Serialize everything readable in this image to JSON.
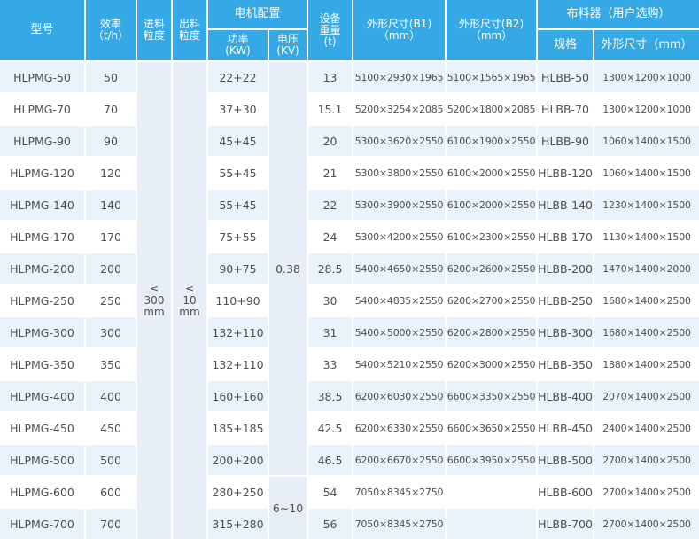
{
  "header": {
    "model": "型号",
    "efficiency": [
      "效率",
      "（t/h）"
    ],
    "feed_size": [
      "进料",
      "粒度"
    ],
    "discharge_size": [
      "出料",
      "粒度"
    ],
    "motor": "电机配置",
    "power": [
      "功率",
      "(KW)"
    ],
    "voltage": [
      "电压",
      "(KV)"
    ],
    "weight": [
      "设备",
      "重量",
      "(t)"
    ],
    "dim_b1": [
      "外形尺寸(B1)",
      "（mm）"
    ],
    "dim_b2": [
      "外形尺寸(B2)",
      "（mm）"
    ],
    "distributor": "布料器（用户选购）",
    "spec": "规格",
    "dist_dim": "外形尺寸（mm）"
  },
  "merged": {
    "feed_size": [
      "≤",
      "300",
      "mm"
    ],
    "discharge_size": [
      "≤",
      "10",
      "mm"
    ],
    "voltage_low": "0.38",
    "voltage_high": "6~10"
  },
  "rows": [
    {
      "model": "HLPMG-50",
      "eff": "50",
      "power": "22+22",
      "weight": "13",
      "b1": "5100×2930×1965",
      "b2": "5100×1565×1965",
      "spec": "HLBB-50",
      "dim": "1300×1200×1000"
    },
    {
      "model": "HLPMG-70",
      "eff": "70",
      "power": "37+30",
      "weight": "15.1",
      "b1": "5200×3254×2085",
      "b2": "5200×1800×2085",
      "spec": "HLBB-70",
      "dim": "1300×1200×1000"
    },
    {
      "model": "HLPMG-90",
      "eff": "90",
      "power": "45+45",
      "weight": "20",
      "b1": "5300×3620×2550",
      "b2": "6100×1900×2550",
      "spec": "HLBB-90",
      "dim": "1060×1400×1500"
    },
    {
      "model": "HLPMG-120",
      "eff": "120",
      "power": "55+45",
      "weight": "21",
      "b1": "5300×3800×2550",
      "b2": "6100×2000×2550",
      "spec": "HLBB-120",
      "dim": "1060×1400×1500"
    },
    {
      "model": "HLPMG-140",
      "eff": "140",
      "power": "55+45",
      "weight": "22",
      "b1": "5300×3900×2550",
      "b2": "6100×2000×2550",
      "spec": "HLBB-140",
      "dim": "1230×1400×1500"
    },
    {
      "model": "HLPMG-170",
      "eff": "170",
      "power": "75+55",
      "weight": "24",
      "b1": "5300×4200×2550",
      "b2": "6100×2300×2550",
      "spec": "HLBB-170",
      "dim": "1130×1400×1500"
    },
    {
      "model": "HLPMG-200",
      "eff": "200",
      "power": "90+75",
      "weight": "28.5",
      "b1": "5400×4650×2550",
      "b2": "6200×2600×2550",
      "spec": "HLBB-200",
      "dim": "1470×1400×2000"
    },
    {
      "model": "HLPMG-250",
      "eff": "250",
      "power": "110+90",
      "weight": "30",
      "b1": "5400×4835×2550",
      "b2": "6200×2700×2550",
      "spec": "HLBB-250",
      "dim": "1680×1400×2500"
    },
    {
      "model": "HLPMG-300",
      "eff": "300",
      "power": "132+110",
      "weight": "31",
      "b1": "5400×5000×2550",
      "b2": "6200×2800×2550",
      "spec": "HLBB-300",
      "dim": "1680×1400×2500"
    },
    {
      "model": "HLPMG-350",
      "eff": "350",
      "power": "132+110",
      "weight": "33",
      "b1": "5400×5210×2550",
      "b2": "6200×3000×2550",
      "spec": "HLBB-350",
      "dim": "1880×1400×2500"
    },
    {
      "model": "HLPMG-400",
      "eff": "400",
      "power": "160+160",
      "weight": "38.5",
      "b1": "6200×6030×2550",
      "b2": "6600×3350×2550",
      "spec": "HLBB-400",
      "dim": "2070×1400×2500"
    },
    {
      "model": "HLPMG-450",
      "eff": "450",
      "power": "185+185",
      "weight": "42.5",
      "b1": "6200×6330×2550",
      "b2": "6600×3650×2550",
      "spec": "HLBB-450",
      "dim": "2400×1400×2500"
    },
    {
      "model": "HLPMG-500",
      "eff": "500",
      "power": "200+200",
      "weight": "46.5",
      "b1": "6200×6670×2550",
      "b2": "6600×3950×2550",
      "spec": "HLBB-500",
      "dim": "2700×1400×2500"
    },
    {
      "model": "HLPMG-600",
      "eff": "600",
      "power": "280+250",
      "weight": "54",
      "b1": "7050×8345×2750",
      "b2": "",
      "spec": "HLBB-600",
      "dim": "2700×1400×2500"
    },
    {
      "model": "HLPMG-700",
      "eff": "700",
      "power": "315+280",
      "weight": "56",
      "b1": "7050×8345×2750",
      "b2": "",
      "spec": "HLBB-700",
      "dim": "2700×1400×2500"
    }
  ]
}
